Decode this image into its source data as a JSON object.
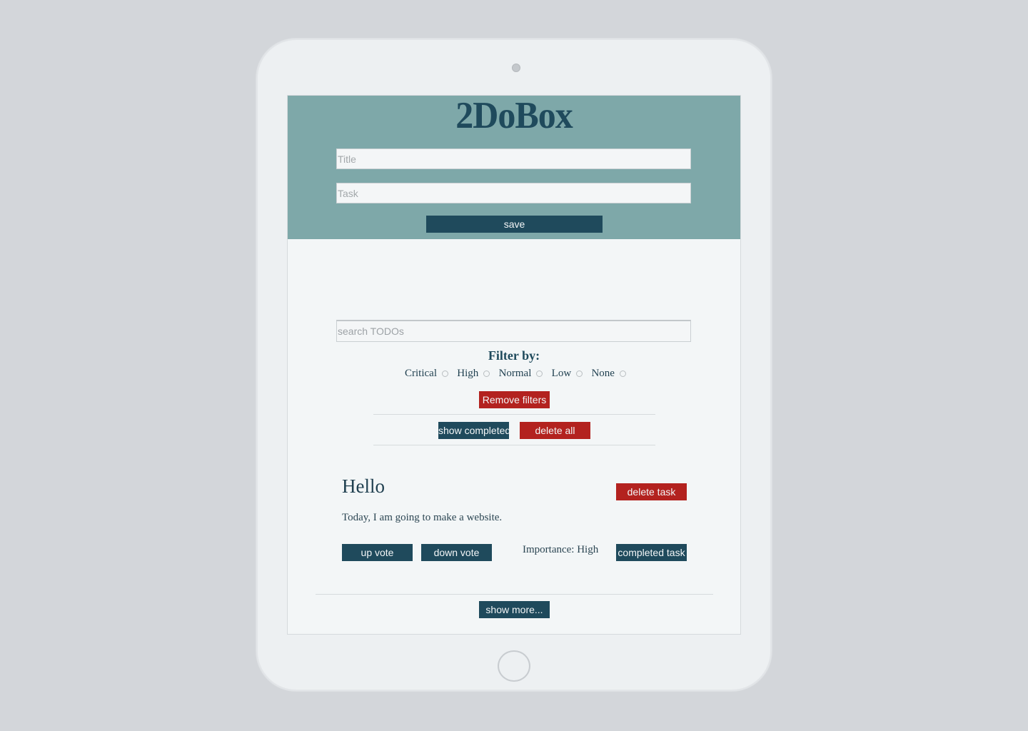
{
  "app": {
    "title": "2DoBox"
  },
  "form": {
    "title_placeholder": "Title",
    "task_placeholder": "Task",
    "save_label": "save"
  },
  "search": {
    "placeholder": "search TODOs"
  },
  "filters": {
    "heading": "Filter by:",
    "options": [
      {
        "label": "Critical"
      },
      {
        "label": "High"
      },
      {
        "label": "Normal"
      },
      {
        "label": "Low"
      },
      {
        "label": "None"
      }
    ],
    "remove_label": "Remove filters"
  },
  "list_actions": {
    "show_completed_label": "show completed",
    "delete_all_label": "delete all"
  },
  "todo": {
    "title": "Hello",
    "body": "Today, I am going to make a website.",
    "delete_label": "delete task",
    "upvote_label": "up vote",
    "downvote_label": "down vote",
    "importance": "Importance: High",
    "complete_label": "completed task"
  },
  "footer": {
    "show_more_label": "show more..."
  },
  "colors": {
    "header_bg": "#7ea8a9",
    "primary": "#1f4a5c",
    "danger": "#b3221f",
    "page_bg": "#d3d6da"
  }
}
